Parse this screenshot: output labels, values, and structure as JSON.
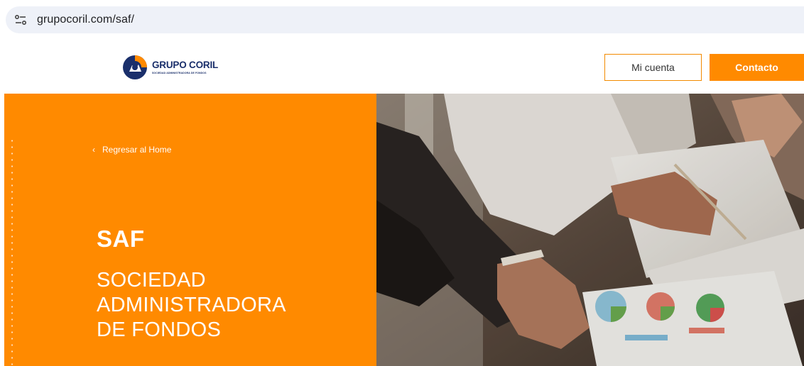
{
  "browser": {
    "url": "grupocoril.com/saf/"
  },
  "header": {
    "logo_name": "GRUPO CORIL",
    "logo_subtitle": "SOCIEDAD ADMINISTRADORA DE FONDOS",
    "account_button": "Mi cuenta",
    "contact_button": "Contacto"
  },
  "hero": {
    "back_chevron": "‹",
    "back_link": "Regresar al Home",
    "title": "SAF",
    "subtitle_lines": [
      "SOCIEDAD",
      "ADMINISTRADORA",
      "DE FONDOS"
    ],
    "photo_icon": "business-meeting-photo"
  },
  "colors": {
    "brand_orange": "#ff8a00",
    "brand_navy": "#1a2f6b",
    "address_bar": "#eef1f8"
  }
}
